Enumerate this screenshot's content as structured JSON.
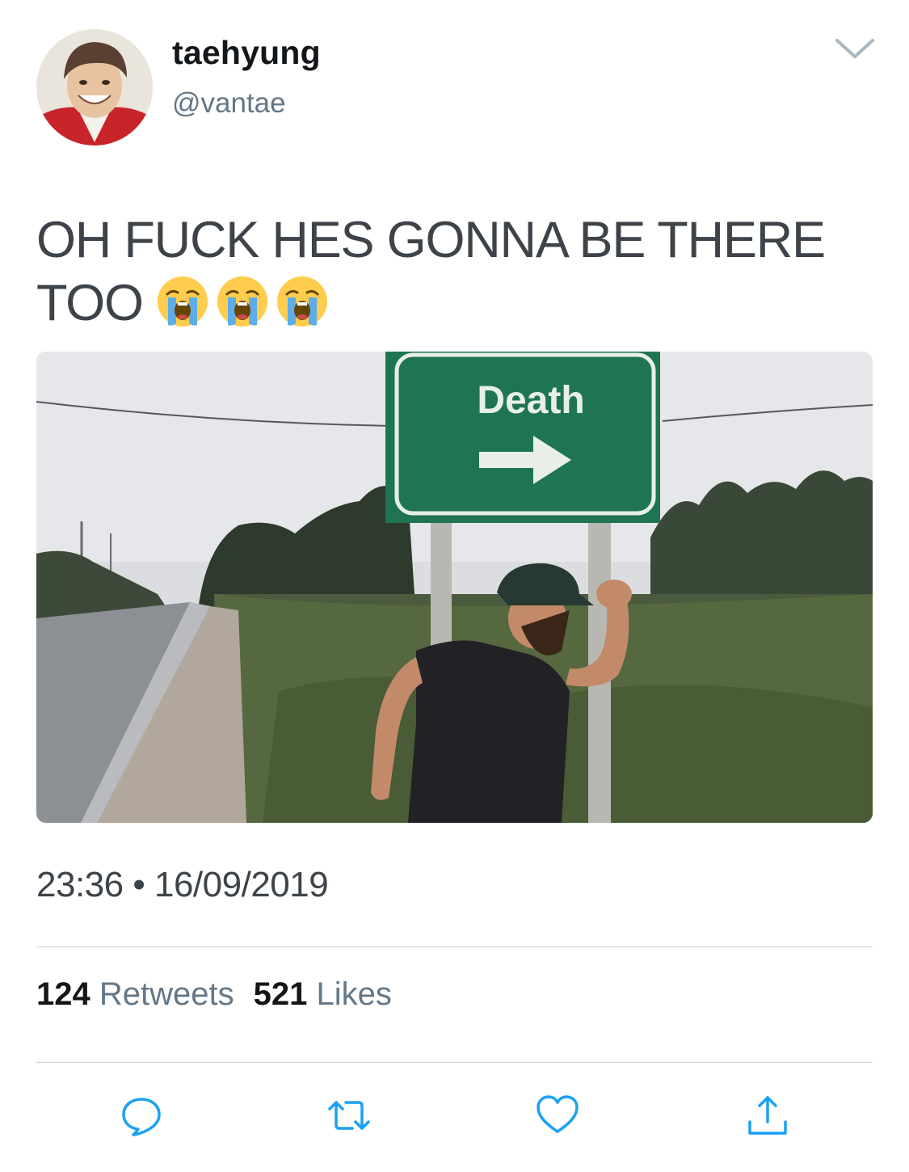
{
  "tweet": {
    "author": {
      "display_name": "taehyung",
      "handle": "@vantae"
    },
    "text": "OH FUCK HES GONNA BE THERE TOO",
    "emojis": [
      "loudly-crying-face",
      "loudly-crying-face",
      "loudly-crying-face"
    ],
    "media": {
      "sign_text": "Death",
      "icon": "right-arrow"
    },
    "time": "23:36",
    "separator": "•",
    "date": "16/09/2019",
    "stats": {
      "retweets_count": "124",
      "retweets_label": "Retweets",
      "likes_count": "521",
      "likes_label": "Likes"
    },
    "actions": [
      "reply-icon",
      "retweet-icon",
      "like-icon",
      "share-icon"
    ]
  },
  "colors": {
    "text_primary": "#14171a",
    "text_secondary": "#657786",
    "tweet_text": "#3d4349",
    "divider": "#cfd6db",
    "sign_green": "#1f7553",
    "icon_blue": "#1da1f2"
  }
}
